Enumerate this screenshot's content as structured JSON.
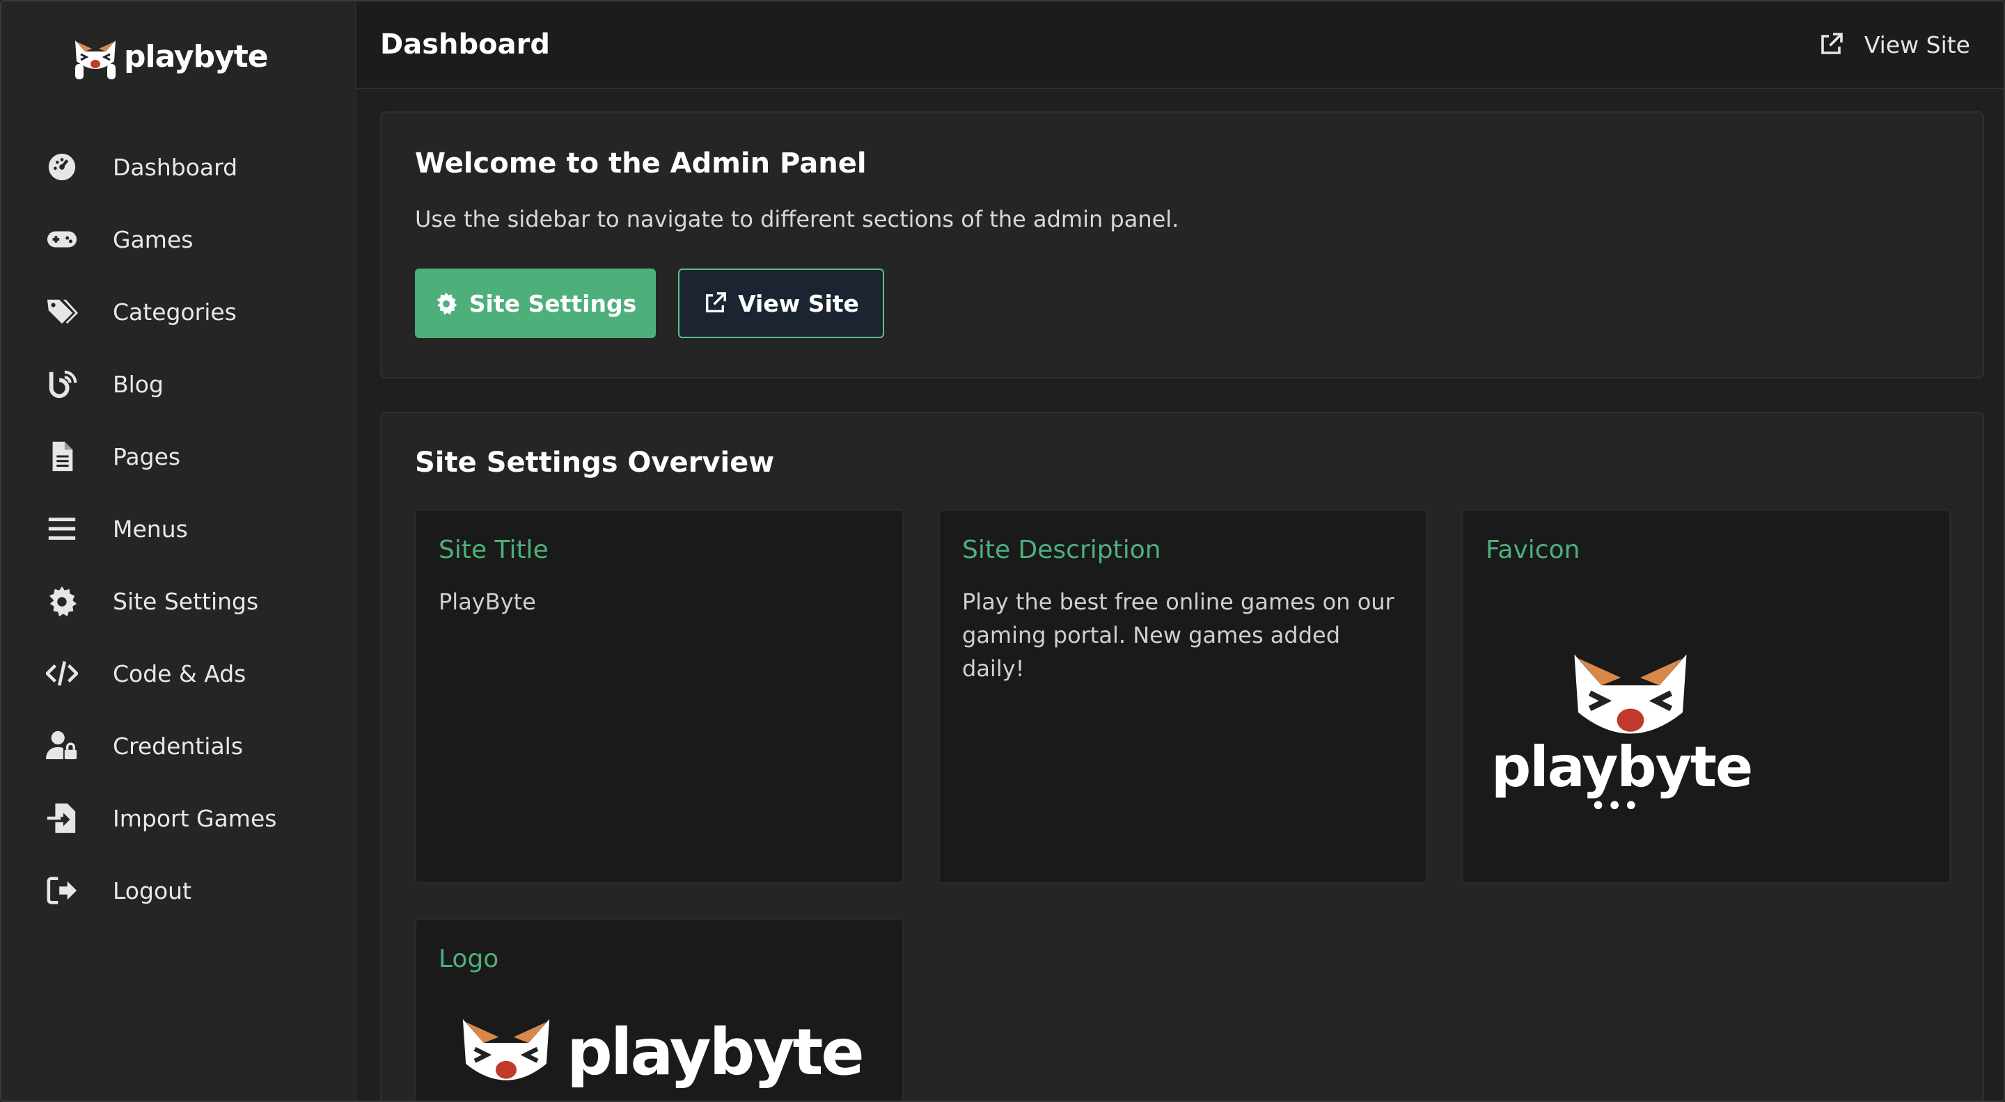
{
  "brand": {
    "name": "playbyte"
  },
  "sidebar": {
    "items": [
      {
        "label": "Dashboard",
        "icon": "gauge-icon"
      },
      {
        "label": "Games",
        "icon": "gamepad-icon"
      },
      {
        "label": "Categories",
        "icon": "tags-icon"
      },
      {
        "label": "Blog",
        "icon": "blog-icon"
      },
      {
        "label": "Pages",
        "icon": "file-icon"
      },
      {
        "label": "Menus",
        "icon": "bars-icon"
      },
      {
        "label": "Site Settings",
        "icon": "gear-icon"
      },
      {
        "label": "Code & Ads",
        "icon": "code-icon"
      },
      {
        "label": "Credentials",
        "icon": "user-lock-icon"
      },
      {
        "label": "Import Games",
        "icon": "file-import-icon"
      },
      {
        "label": "Logout",
        "icon": "sign-out-icon"
      }
    ]
  },
  "header": {
    "title": "Dashboard",
    "view_site_label": "View Site"
  },
  "welcome": {
    "title": "Welcome to the Admin Panel",
    "description": "Use the sidebar to navigate to different sections of the admin panel.",
    "settings_button": "Site Settings",
    "view_site_button": "View Site"
  },
  "overview": {
    "title": "Site Settings Overview",
    "site_title": {
      "label": "Site Title",
      "value": "PlayByte"
    },
    "site_description": {
      "label": "Site Description",
      "value": "Play the best free online games on our gaming portal. New games added daily!"
    },
    "favicon": {
      "label": "Favicon"
    },
    "logo": {
      "label": "Logo"
    }
  },
  "colors": {
    "accent": "#4db07b",
    "background": "#1f1f1f",
    "sidebar": "#252525",
    "tile": "#1a1a1a"
  }
}
